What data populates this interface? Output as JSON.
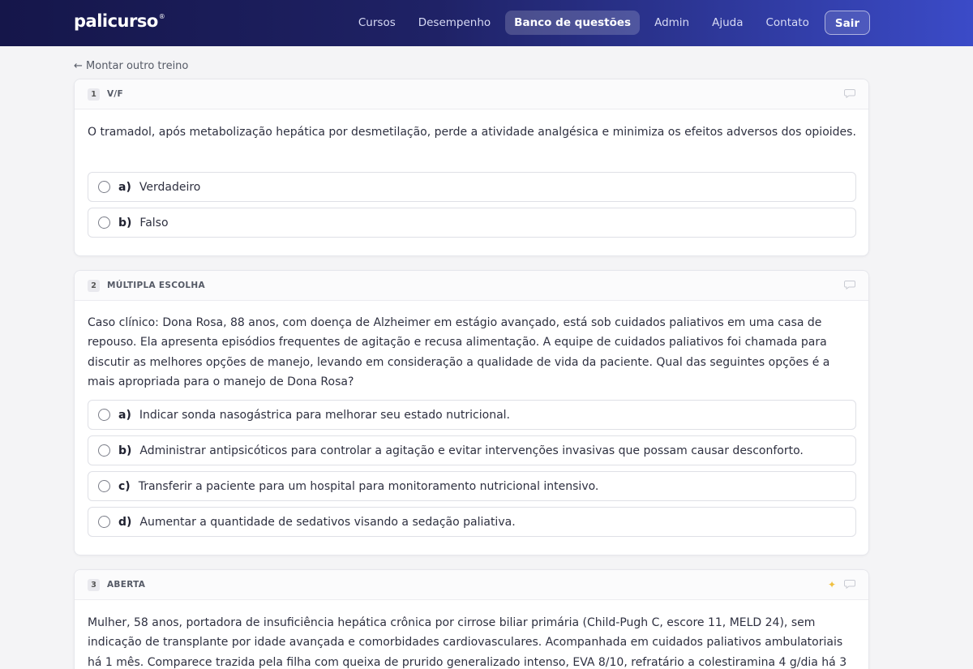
{
  "brand": {
    "name": "palicurso",
    "mark": "®"
  },
  "nav": {
    "items": [
      "Cursos",
      "Desempenho",
      "Banco de questões",
      "Admin",
      "Ajuda",
      "Contato"
    ],
    "active_index": 2,
    "logout": "Sair"
  },
  "back_link": "← Montar outro treino",
  "questions": [
    {
      "number": "1",
      "type": "V/F",
      "text": "O tramadol, após metabolização hepática por desmetilação, perde a atividade analgésica e minimiza os efeitos adversos dos opioides.",
      "options": [
        {
          "letter": "a)",
          "text": "Verdadeiro"
        },
        {
          "letter": "b)",
          "text": "Falso"
        }
      ]
    },
    {
      "number": "2",
      "type": "MÚLTIPLA ESCOLHA",
      "text": "Caso clínico: Dona Rosa, 88 anos, com doença de Alzheimer em estágio avançado, está sob cuidados paliativos em uma casa de repouso. Ela apresenta episódios frequentes de agitação e recusa alimentação. A equipe de cuidados paliativos foi chamada para discutir as melhores opções de manejo, levando em consideração a qualidade de vida da paciente. Qual das seguintes opções é a mais apropriada para o manejo de Dona Rosa?",
      "options": [
        {
          "letter": "a)",
          "text": "Indicar sonda nasogástrica para melhorar seu estado nutricional."
        },
        {
          "letter": "b)",
          "text": "Administrar antipsicóticos para controlar a agitação e evitar intervenções invasivas que possam causar desconforto."
        },
        {
          "letter": "c)",
          "text": "Transferir a paciente para um hospital para monitoramento nutricional intensivo."
        },
        {
          "letter": "d)",
          "text": "Aumentar a quantidade de sedativos visando a sedação paliativa."
        }
      ]
    },
    {
      "number": "3",
      "type": "ABERTA",
      "text": "Mulher, 58 anos, portadora de insuficiência hepática crônica por cirrose biliar primária (Child-Pugh C, escore 11, MELD 24), sem indicação de transplante por idade avançada e comorbidades cardiovasculares. Acompanhada em cuidados paliativos ambulatoriais há 1 mês. Comparece trazida pela filha com queixa de prurido generalizado intenso, EVA 8/10, refratário a colestiramina 4 g/dia há 3"
    }
  ]
}
